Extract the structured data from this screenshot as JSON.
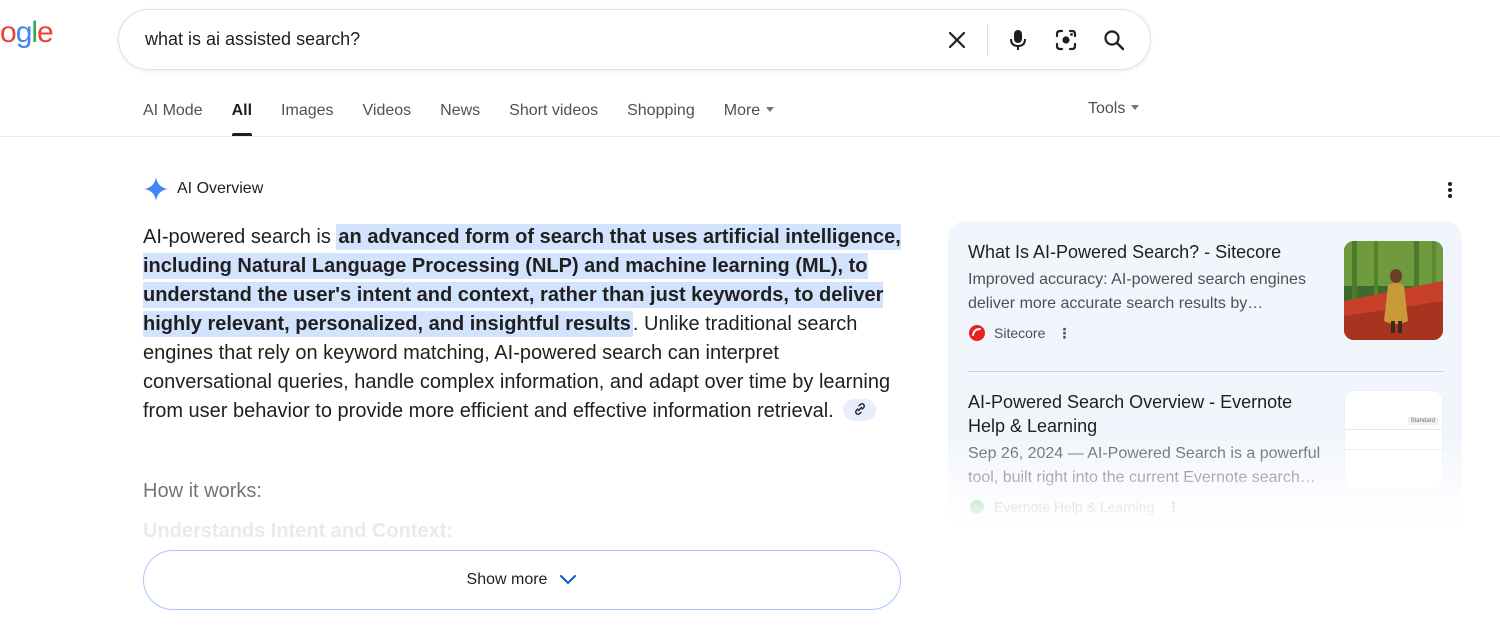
{
  "search": {
    "query": "what is ai assisted search?"
  },
  "logo_text": "ogle",
  "tabs": [
    {
      "label": "AI Mode"
    },
    {
      "label": "All"
    },
    {
      "label": "Images"
    },
    {
      "label": "Videos"
    },
    {
      "label": "News"
    },
    {
      "label": "Short videos"
    },
    {
      "label": "Shopping"
    },
    {
      "label": "More"
    }
  ],
  "tools_label": "Tools",
  "ai_overview": {
    "title": "AI Overview",
    "lead": "AI-powered search is ",
    "highlight": "an advanced form of search that uses artificial intelligence, including Natural Language Processing (NLP) and machine learning (ML), to understand the user's intent and context, rather than just keywords, to deliver highly relevant, personalized, and insightful results",
    "after_highlight": ".",
    "rest": " Unlike traditional search engines that rely on keyword matching, AI-powered search can interpret conversational queries, handle complex information, and adapt over time by learning from user behavior to provide more efficient and effective information retrieval.",
    "how_heading": "How it works:",
    "faded_line": "Understands Intent and Context:",
    "show_more_label": "Show more"
  },
  "sources": [
    {
      "title": "What Is AI-Powered Search? - Sitecore",
      "snippet": "Improved accuracy: AI-powered search engines deliver more accurate search results by…",
      "site": "Sitecore"
    },
    {
      "title": "AI-Powered Search Overview - Evernote Help & Learning",
      "snippet": "Sep 26, 2024 — AI-Powered Search is a powerful tool, built right into the current Evernote search…",
      "site": "Evernote Help & Learning",
      "thumb_label": "Standard"
    }
  ],
  "colors": {
    "highlight": "#d3e3fd",
    "source_panel": "#f1f5fc",
    "show_more_border": "#a8c7fa",
    "ai_star": "#4285f4",
    "sitecore": "#eb1f1f"
  }
}
